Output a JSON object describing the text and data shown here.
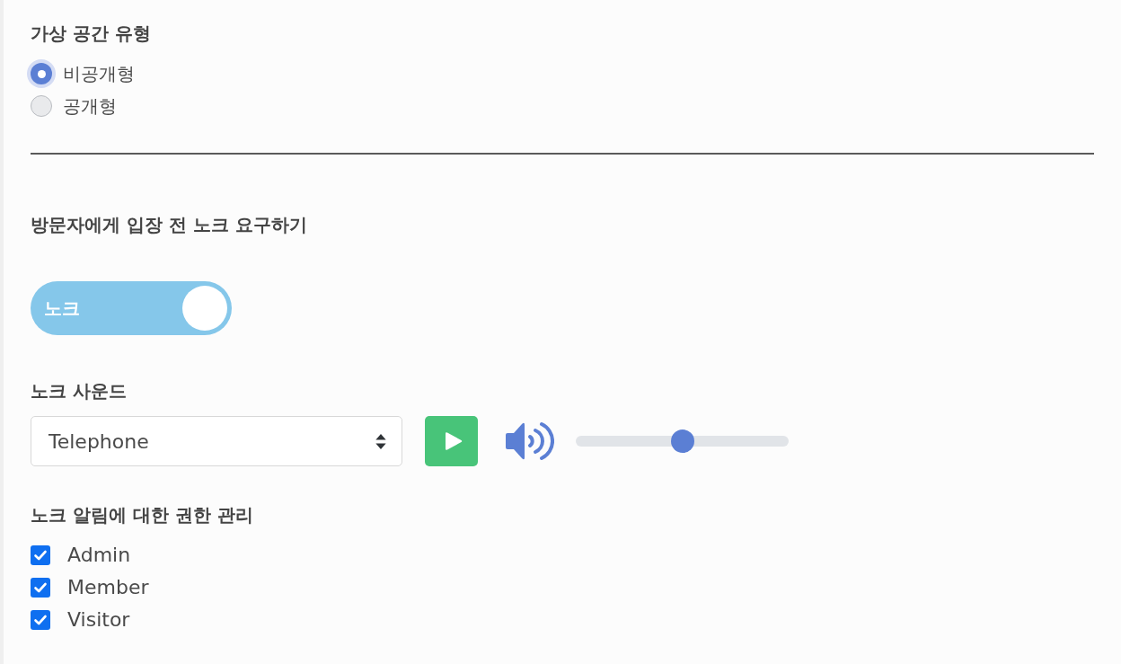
{
  "space_type": {
    "title": "가상 공간 유형",
    "options": [
      {
        "label": "비공개형",
        "selected": true
      },
      {
        "label": "공개형",
        "selected": false
      }
    ]
  },
  "knock_required": {
    "title": "방문자에게 입장 전 노크 요구하기",
    "toggle": {
      "label": "노크",
      "on": true
    }
  },
  "knock_sound": {
    "title": "노크 사운드",
    "select": {
      "value": "Telephone"
    },
    "volume": {
      "level": 0.5
    }
  },
  "permissions": {
    "title": "노크 알림에 대한 권한 관리",
    "roles": [
      {
        "label": "Admin",
        "checked": true
      },
      {
        "label": "Member",
        "checked": true
      },
      {
        "label": "Visitor",
        "checked": true
      }
    ]
  }
}
